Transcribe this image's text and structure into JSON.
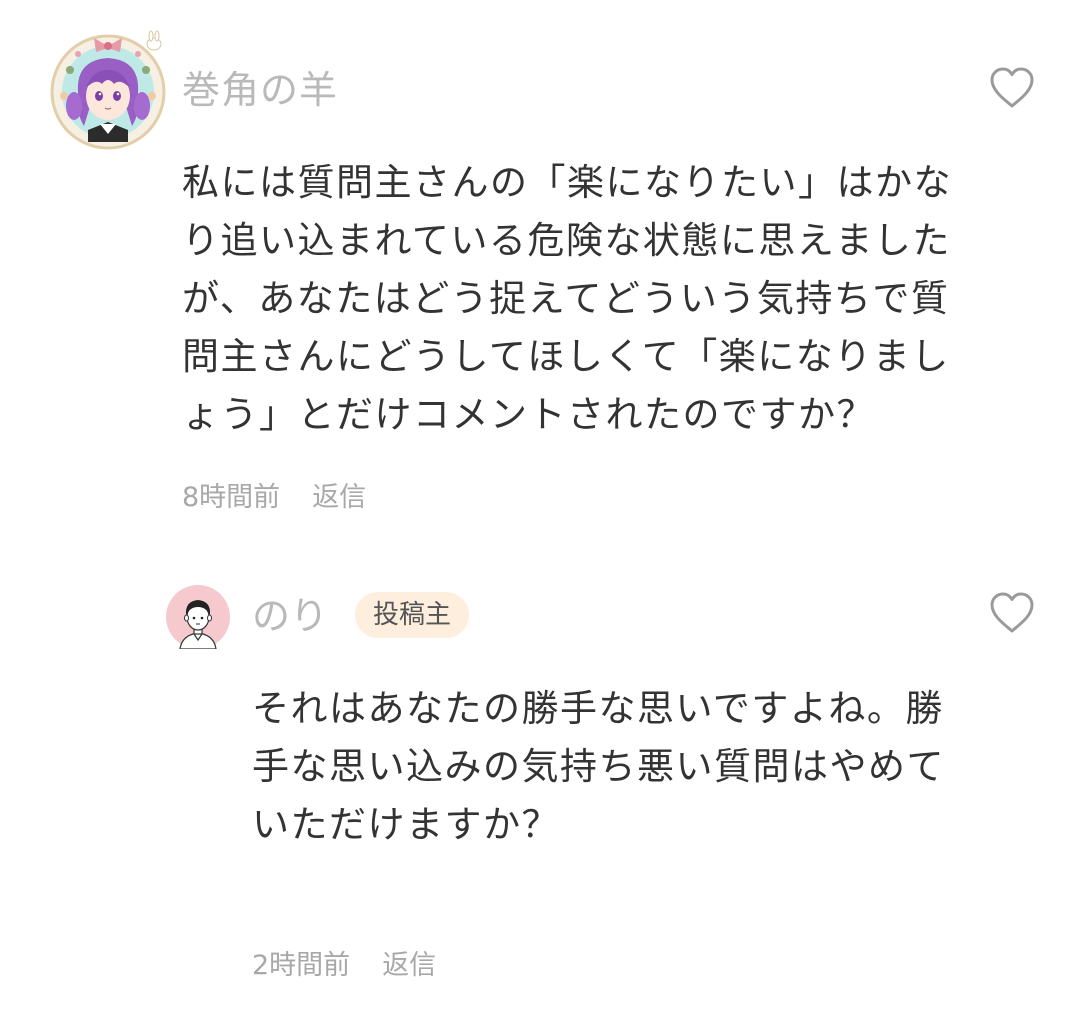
{
  "comments": [
    {
      "avatar_icon": "anime-girl-avatar-icon",
      "username": "巻角の羊",
      "like_icon": "heart-outline-icon",
      "body_lines": [
        "私には質問主さんの「楽になりたい」はかな",
        "り追い込まれている危険な状態に思えました",
        "が、あなたはどう捉えてどういう気持ちで質",
        "問主さんにどうしてほしくて「楽になりまし",
        "ょう」とだけコメントされたのですか？"
      ],
      "timestamp": "8時間前",
      "reply_label": "返信"
    },
    {
      "avatar_icon": "man-avatar-icon",
      "username": "のり",
      "badge": "投稿主",
      "like_icon": "heart-outline-icon",
      "body_lines": [
        "それはあなたの勝手な思いですよね。勝",
        "手な思い込みの気持ち悪い質問はやめて",
        "いただけますか？"
      ],
      "timestamp": "2時間前",
      "reply_label": "返信"
    }
  ],
  "colors": {
    "username": "#b9b9b9",
    "body_text": "#333333",
    "meta_text": "#a8a8a8",
    "badge_bg": "#fdeedd",
    "heart_stroke": "#9a9a9a"
  }
}
